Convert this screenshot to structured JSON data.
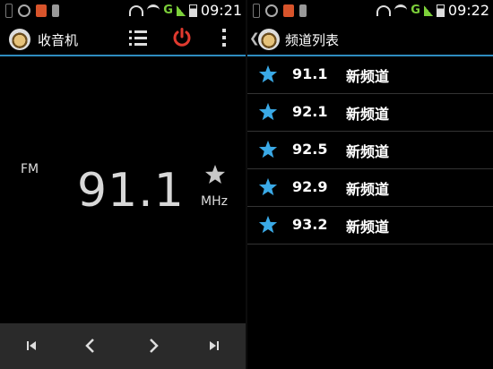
{
  "left": {
    "status": {
      "time": "09:21",
      "network": "G"
    },
    "app_title": "收音机",
    "band": "FM",
    "frequency": "91.1",
    "unit": "MHz",
    "favorite": false,
    "icons": [
      "list-icon",
      "power-icon",
      "overflow-menu-icon",
      "skip-previous-icon",
      "chevron-left-icon",
      "chevron-right-icon",
      "skip-next-icon"
    ]
  },
  "right": {
    "status": {
      "time": "09:22",
      "network": "G"
    },
    "title": "频道列表",
    "channels": [
      {
        "freq": "91.1",
        "name": "新频道",
        "favorite": true
      },
      {
        "freq": "92.1",
        "name": "新频道",
        "favorite": true
      },
      {
        "freq": "92.5",
        "name": "新频道",
        "favorite": true
      },
      {
        "freq": "92.9",
        "name": "新频道",
        "favorite": true
      },
      {
        "freq": "93.2",
        "name": "新频道",
        "favorite": true
      }
    ]
  },
  "colors": {
    "accent": "#2e8cbf",
    "power": "#e03a2f",
    "star_active": "#3aa9e6",
    "star_inactive": "#c8c8c8",
    "control_bar": "#2a2a2a"
  }
}
